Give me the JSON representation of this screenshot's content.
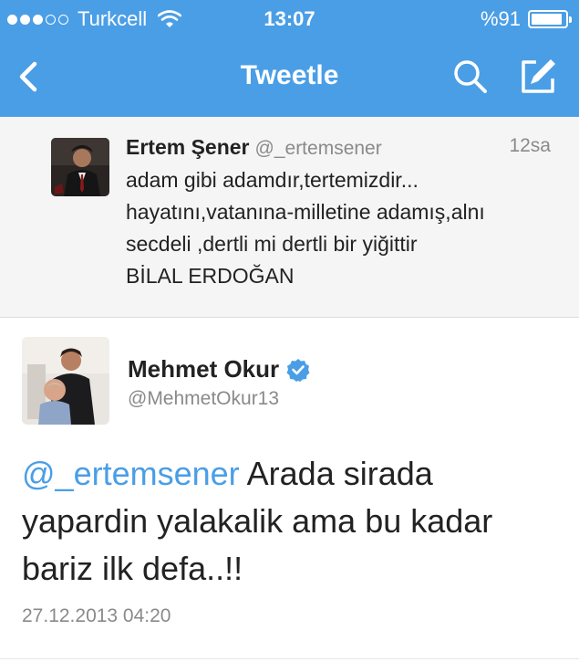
{
  "status_bar": {
    "carrier": "Turkcell",
    "time": "13:07",
    "battery_text": "%91",
    "battery_level": 0.91,
    "signal_bars_filled": 3,
    "signal_bars_total": 5
  },
  "nav": {
    "title": "Tweetle",
    "back_icon": "chevron-left-icon",
    "search_icon": "search-icon",
    "compose_icon": "compose-icon"
  },
  "reply_tweet": {
    "name": "Ertem Şener",
    "handle": "@_ertemsener",
    "time": "12sa",
    "lines": [
      "adam gibi adamdır,tertemizdir...",
      "hayatını,vatanına-milletine adamış,alnı",
      "secdeli ,dertli mi dertli bir yiğittir",
      "BİLAL ERDOĞAN"
    ]
  },
  "main_tweet": {
    "name": "Mehmet Okur",
    "handle": "@MehmetOkur13",
    "verified_icon": "verified-badge-icon",
    "mention": "@_ertemsener",
    "line1_rest": " Arada sirada",
    "line2": "yapardin yalakalik ama bu kadar",
    "line3": "bariz ilk defa..!!",
    "date": "27.12.2013 04:20"
  },
  "colors": {
    "brand_blue": "#4a9ee6",
    "text_dark": "#222222",
    "text_gray": "#8a8a8a",
    "reply_bg": "#f5f5f5"
  }
}
